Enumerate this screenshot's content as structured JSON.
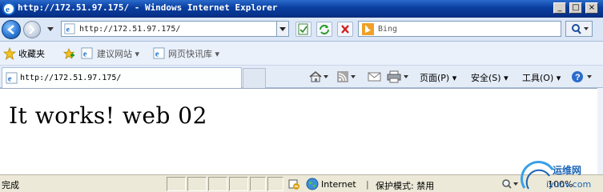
{
  "window": {
    "title": "http://172.51.97.175/ - Windows Internet Explorer",
    "minimize": "_",
    "maximize": "□",
    "close": "×"
  },
  "nav": {
    "address": "http://172.51.97.175/",
    "search_placeholder": "Bing"
  },
  "favorites": {
    "label": "收藏夹",
    "items": [
      {
        "label": "建议网站",
        "arrow": "▾"
      },
      {
        "label": "网页快讯库",
        "arrow": "▾"
      }
    ]
  },
  "tabs": {
    "active": "http://172.51.97.175/"
  },
  "commandbar": {
    "page": "页面(P)",
    "safety": "安全(S)",
    "tools": "工具(O)",
    "arrow": "▾"
  },
  "page": {
    "text": "It works! web 02"
  },
  "status": {
    "text": "完成",
    "zone": "Internet",
    "protected_mode": "保护模式: 禁用",
    "zoom": "100%"
  },
  "watermark": {
    "line1": "运维网",
    "line2": "iyunv.com"
  },
  "colors": {
    "titlebar": "#0a3fa0",
    "accent_orange": "#f0a028",
    "link_blue": "#1a64b6"
  }
}
